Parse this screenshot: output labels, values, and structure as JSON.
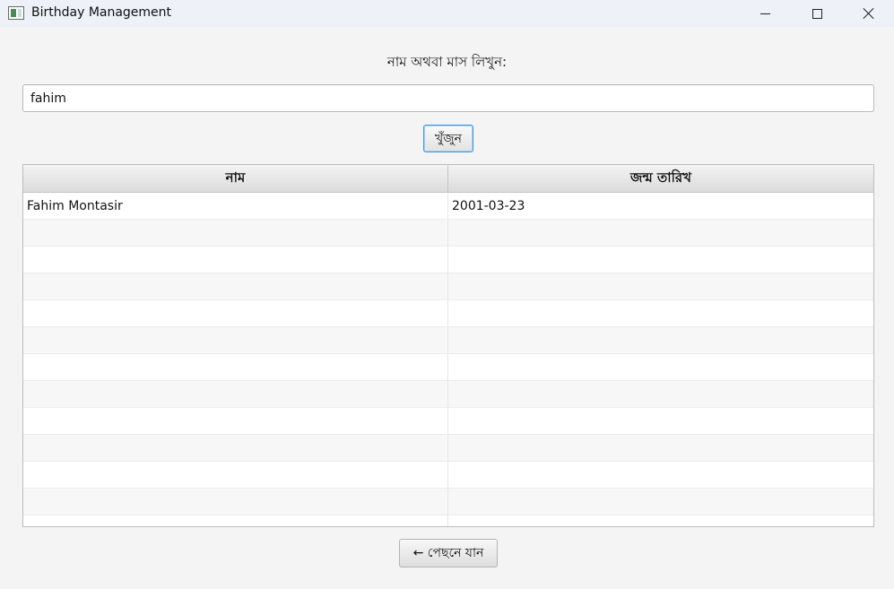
{
  "window": {
    "title": "Birthday Management",
    "icon": "app-window-icon"
  },
  "search": {
    "prompt": "নাম অথবা মাস লিখুন:",
    "value": "fahim",
    "button_label": "খুঁজুন"
  },
  "table": {
    "headers": [
      "নাম",
      "জন্ম তারিখ"
    ],
    "rows": [
      [
        "Fahim Montasir",
        "2001-03-23"
      ],
      [
        "",
        ""
      ],
      [
        "",
        ""
      ],
      [
        "",
        ""
      ],
      [
        "",
        ""
      ],
      [
        "",
        ""
      ],
      [
        "",
        ""
      ],
      [
        "",
        ""
      ],
      [
        "",
        ""
      ],
      [
        "",
        ""
      ],
      [
        "",
        ""
      ],
      [
        "",
        ""
      ],
      [
        "",
        ""
      ]
    ]
  },
  "footer": {
    "back_label": "← পেছনে যান"
  }
}
